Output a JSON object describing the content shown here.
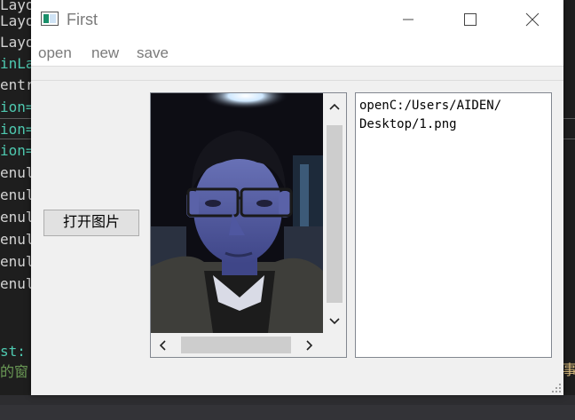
{
  "editor": {
    "lines": [
      {
        "text": "Layo",
        "color": "gray"
      },
      {
        "text": "Layo",
        "color": "gray"
      },
      {
        "text": "inLa",
        "color": "green"
      },
      {
        "text": "entr",
        "color": "gray"
      },
      {
        "text": "ion=",
        "color": "green"
      },
      {
        "text": "ion=",
        "color": "green"
      },
      {
        "text": "ion=",
        "color": "green"
      },
      {
        "text": "enul",
        "color": "gray"
      },
      {
        "text": "enul",
        "color": "gray"
      },
      {
        "text": "enul",
        "color": "gray"
      },
      {
        "text": "enul",
        "color": "gray"
      },
      {
        "text": "enul",
        "color": "gray"
      },
      {
        "text": "enul",
        "color": "gray"
      },
      {
        "text": "st:",
        "color": "green"
      },
      {
        "text": "的窗",
        "color": "lime"
      }
    ],
    "right_edge_char": "事"
  },
  "window": {
    "title": "First",
    "menu": [
      "open",
      "new",
      "save"
    ],
    "open_button_label": "打开图片",
    "text_content": "openC:/Users/AIDEN/\nDesktop/1.png"
  },
  "colors": {
    "editor_bg": "#1e1e1e",
    "window_bg": "#f0f0f0",
    "title_text": "#7a7a7a"
  }
}
